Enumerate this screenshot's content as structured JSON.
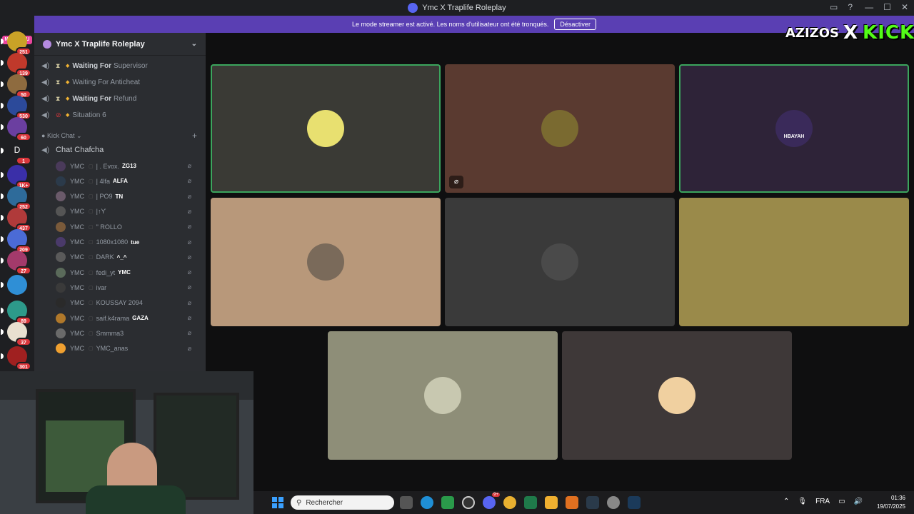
{
  "window": {
    "title": "Ymc X Traplife Roleplay",
    "controls": [
      "—",
      "☐",
      "✕"
    ]
  },
  "banner": {
    "text": "Le mode streamer est activé. Les noms d'utilisateur ont été tronqués.",
    "button": "Désactiver"
  },
  "rail": {
    "nouveau": "NOUVEAU",
    "servers": [
      {
        "badge": "251",
        "color": "#c9a227"
      },
      {
        "badge": "139",
        "color": "#c0392b"
      },
      {
        "badge": "50",
        "color": "#8e6b3f"
      },
      {
        "badge": "530",
        "color": "#2c4a9a"
      },
      {
        "badge": "60",
        "color": "#6b3fa0"
      },
      {
        "label": "D",
        "badge": "1",
        "color": "#1e1f22"
      },
      {
        "badge": "1K+",
        "color": "#3a2fa8"
      },
      {
        "badge": "252",
        "color": "#2e6b9a"
      },
      {
        "badge": "437",
        "color": "#b03a3a"
      },
      {
        "badge": "209",
        "color": "#4b6bd6"
      },
      {
        "badge": "27",
        "color": "#a33a6b"
      },
      {
        "badge": "",
        "color": "#2f8fd6"
      },
      {
        "badge": "89",
        "color": "#2d9a8a"
      },
      {
        "badge": "37",
        "color": "#e8e0d0"
      },
      {
        "badge": "301",
        "color": "#a02020"
      }
    ]
  },
  "sidebar": {
    "server_name": "Ymc X Traplife Roleplay",
    "voice_channels": [
      {
        "bold": "Waiting For",
        "rest": "Supervisor",
        "icon": "hourglass"
      },
      {
        "bold": "",
        "rest": "Waiting For Anticheat",
        "icon": "hourglass"
      },
      {
        "bold": "Waiting For",
        "rest": "Refund",
        "icon": "hourglass"
      },
      {
        "bold": "",
        "rest": "Situation 6",
        "icon": "no-entry"
      }
    ],
    "category": "Kick Chat",
    "active_channel": "Chat Chafcha",
    "members": [
      {
        "tag": "YMC",
        "name": "| . Evox.",
        "extra": "ZG13",
        "color": "#4a3a5a"
      },
      {
        "tag": "YMC",
        "name": "| 4lfa",
        "extra": "ALFA",
        "color": "#2b3a4a"
      },
      {
        "tag": "YMC",
        "name": "| PO9",
        "extra": "TN",
        "color": "#6a5a6a"
      },
      {
        "tag": "YMC",
        "name": "|↑ϒ",
        "extra": "",
        "color": "#555"
      },
      {
        "tag": "YMC",
        "name": "\" ROLLO",
        "extra": "",
        "color": "#7a5a3a"
      },
      {
        "tag": "YMC",
        "name": "1080x1080",
        "extra": "tue",
        "color": "#4a3a6a"
      },
      {
        "tag": "YMC",
        "name": "DARK",
        "extra": "^_^",
        "color": "#5a5a5a"
      },
      {
        "tag": "YMC",
        "name": "fedi_yt",
        "extra": "YMC",
        "color": "#5a6a5a"
      },
      {
        "tag": "YMC",
        "name": "ivar",
        "extra": "",
        "color": "#3a3a3a"
      },
      {
        "tag": "YMC",
        "name": "KOUSSAY 2094",
        "extra": "",
        "color": "#2a2a2a"
      },
      {
        "tag": "YMC",
        "name": "saif.k4rama",
        "extra": "GAZA",
        "color": "#b0782a"
      },
      {
        "tag": "YMC",
        "name": "Smmma3",
        "extra": "",
        "color": "#6a6a6a"
      },
      {
        "tag": "YMC",
        "name": "YMC_anas",
        "extra": "",
        "color": "#f0a030"
      }
    ]
  },
  "tiles": [
    {
      "bg": "#3a3a35",
      "avatar": "#e8e070",
      "speaking": true,
      "muted": false
    },
    {
      "bg": "#5a3a30",
      "avatar": "#7a6a30",
      "speaking": false,
      "muted": true
    },
    {
      "bg": "#2e2338",
      "avatar": "#3a2a5a",
      "speaking": true,
      "muted": false,
      "avatar_label": "HBAYAH"
    },
    {
      "bg": "#b8987a",
      "avatar": "#7a6a5a",
      "speaking": false,
      "muted": false
    },
    {
      "bg": "#3a3a3a",
      "avatar": "#4a4a4a",
      "speaking": false,
      "muted": false
    },
    {
      "bg": "#9a8a4a",
      "avatar": "#9a8a4a",
      "speaking": false,
      "muted": false
    },
    {
      "bg": "#8e8e78",
      "avatar": "#c8c8b0",
      "speaking": false,
      "muted": false
    },
    {
      "bg": "#3e3838",
      "avatar": "#f0d0a0",
      "speaking": false,
      "muted": false
    }
  ],
  "overlay": {
    "left": "AZIZOS",
    "x": "X",
    "right": "KICK"
  },
  "taskbar": {
    "search_placeholder": "Rechercher",
    "lang": "FRA",
    "time": "01:36",
    "date": "19/07/2025",
    "discord_badge": "9+"
  }
}
